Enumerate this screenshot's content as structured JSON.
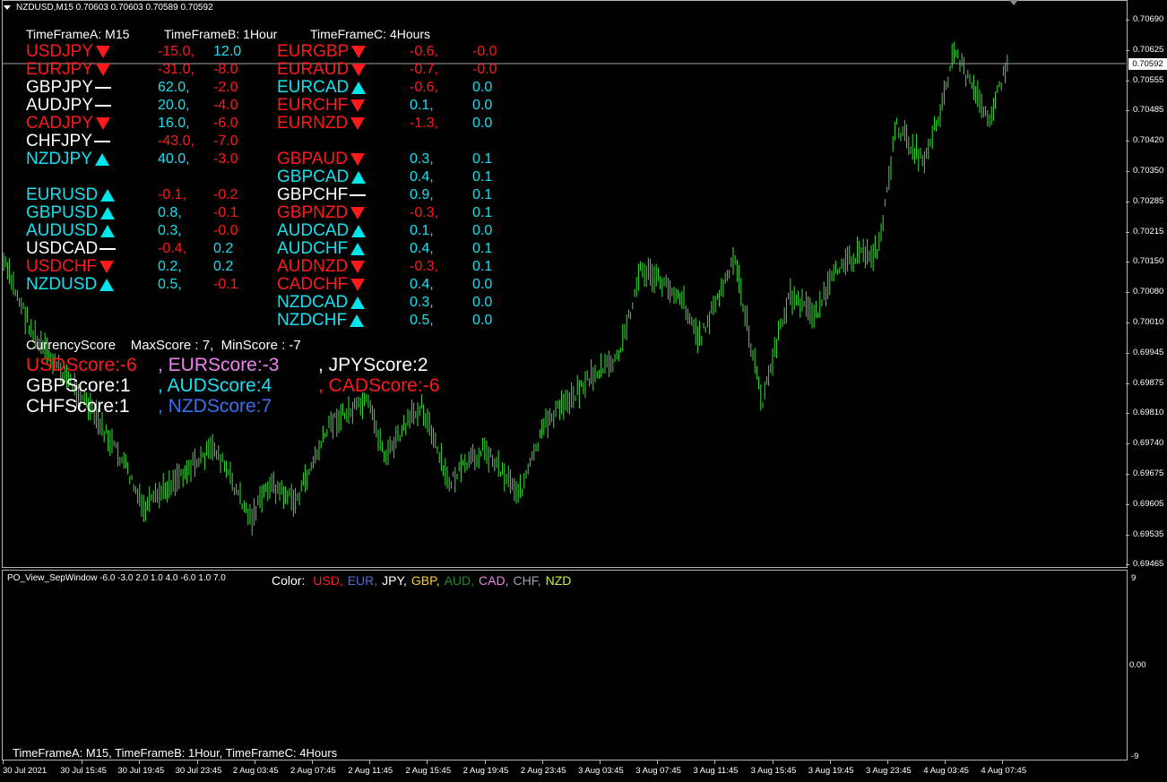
{
  "window": {
    "title": "NZDUSD,M15  0.70603 0.70603 0.70589 0.70592",
    "current_price": "0.70592"
  },
  "y_axis": [
    "0.70690",
    "0.70625",
    "0.70555",
    "0.70485",
    "0.70420",
    "0.70350",
    "0.70285",
    "0.70215",
    "0.70150",
    "0.70080",
    "0.70010",
    "0.69945",
    "0.69875",
    "0.69810",
    "0.69740",
    "0.69675",
    "0.69605",
    "0.69535",
    "0.69465"
  ],
  "x_axis": [
    "30 Jul 2021",
    "30 Jul 15:45",
    "30 Jul 19:45",
    "30 Jul 23:45",
    "2 Aug 03:45",
    "2 Aug 07:45",
    "2 Aug 11:45",
    "2 Aug 15:45",
    "2 Aug 19:45",
    "2 Aug 23:45",
    "3 Aug 03:45",
    "3 Aug 07:45",
    "3 Aug 11:45",
    "3 Aug 15:45",
    "3 Aug 19:45",
    "3 Aug 23:45",
    "4 Aug 03:45",
    "4 Aug 07:45"
  ],
  "headers": {
    "a": "TimeFrameA: M15",
    "b": "TimeFrameB: 1Hour",
    "c": "TimeFrameC: 4Hours"
  },
  "col1": [
    {
      "pair": "USDJPY",
      "dir": "down",
      "color": "red",
      "v1": "-15.0,",
      "c1": "red",
      "v2": "12.0",
      "c2": "cyan"
    },
    {
      "pair": "EURJPY",
      "dir": "down",
      "color": "red",
      "v1": "-31.0,",
      "c1": "red",
      "v2": "-8.0",
      "c2": "red"
    },
    {
      "pair": "GBPJPY",
      "dir": "flat",
      "color": "white",
      "v1": "62.0,",
      "c1": "cyan",
      "v2": "-2.0",
      "c2": "red"
    },
    {
      "pair": "AUDJPY",
      "dir": "flat",
      "color": "white",
      "v1": "20.0,",
      "c1": "cyan",
      "v2": "-4.0",
      "c2": "red"
    },
    {
      "pair": "CADJPY",
      "dir": "down",
      "color": "red",
      "v1": "16.0,",
      "c1": "cyan",
      "v2": "-6.0",
      "c2": "red"
    },
    {
      "pair": "CHFJPY",
      "dir": "flat",
      "color": "white",
      "v1": "-43.0,",
      "c1": "red",
      "v2": "-7.0",
      "c2": "red"
    },
    {
      "pair": "NZDJPY",
      "dir": "up",
      "color": "cyan",
      "v1": "40.0,",
      "c1": "cyan",
      "v2": "-3.0",
      "c2": "red"
    },
    {
      "pair": "",
      "dir": "",
      "color": "",
      "v1": "",
      "c1": "",
      "v2": "",
      "c2": ""
    },
    {
      "pair": "EURUSD",
      "dir": "up",
      "color": "cyan",
      "v1": "-0.1,",
      "c1": "red",
      "v2": "-0.2",
      "c2": "red"
    },
    {
      "pair": "GBPUSD",
      "dir": "up",
      "color": "cyan",
      "v1": "0.8,",
      "c1": "cyan",
      "v2": "-0.1",
      "c2": "red"
    },
    {
      "pair": "AUDUSD",
      "dir": "up",
      "color": "cyan",
      "v1": "0.3,",
      "c1": "cyan",
      "v2": "-0.0",
      "c2": "red"
    },
    {
      "pair": "USDCAD",
      "dir": "flat",
      "color": "white",
      "v1": "-0.4,",
      "c1": "red",
      "v2": "0.2",
      "c2": "cyan"
    },
    {
      "pair": "USDCHF",
      "dir": "down",
      "color": "red",
      "v1": "0.2,",
      "c1": "cyan",
      "v2": "0.2",
      "c2": "cyan"
    },
    {
      "pair": "NZDUSD",
      "dir": "up",
      "color": "cyan",
      "v1": "0.5,",
      "c1": "cyan",
      "v2": "-0.1",
      "c2": "red"
    }
  ],
  "col2": [
    {
      "pair": "EURGBP",
      "dir": "down",
      "color": "red",
      "v1": "-0.6,",
      "c1": "red",
      "v2": "-0.0",
      "c2": "red"
    },
    {
      "pair": "EURAUD",
      "dir": "down",
      "color": "red",
      "v1": "-0.7,",
      "c1": "red",
      "v2": "-0.0",
      "c2": "red"
    },
    {
      "pair": "EURCAD",
      "dir": "up",
      "color": "cyan",
      "v1": "-0.6,",
      "c1": "red",
      "v2": "0.0",
      "c2": "cyan"
    },
    {
      "pair": "EURCHF",
      "dir": "down",
      "color": "red",
      "v1": "0.1,",
      "c1": "cyan",
      "v2": "0.0",
      "c2": "cyan"
    },
    {
      "pair": "EURNZD",
      "dir": "down",
      "color": "red",
      "v1": "-1.3,",
      "c1": "red",
      "v2": "0.0",
      "c2": "cyan"
    },
    {
      "pair": "",
      "dir": "",
      "color": "",
      "v1": "",
      "c1": "",
      "v2": "",
      "c2": ""
    },
    {
      "pair": "GBPAUD",
      "dir": "down",
      "color": "red",
      "v1": "0.3,",
      "c1": "cyan",
      "v2": "0.1",
      "c2": "cyan"
    },
    {
      "pair": "GBPCAD",
      "dir": "up",
      "color": "cyan",
      "v1": "0.4,",
      "c1": "cyan",
      "v2": "0.1",
      "c2": "cyan"
    },
    {
      "pair": "GBPCHF",
      "dir": "flat",
      "color": "white",
      "v1": "0.9,",
      "c1": "cyan",
      "v2": "0.1",
      "c2": "cyan"
    },
    {
      "pair": "GBPNZD",
      "dir": "down",
      "color": "red",
      "v1": "-0.3,",
      "c1": "red",
      "v2": "0.1",
      "c2": "cyan"
    },
    {
      "pair": "AUDCAD",
      "dir": "up",
      "color": "cyan",
      "v1": "0.1,",
      "c1": "cyan",
      "v2": "0.0",
      "c2": "cyan"
    },
    {
      "pair": "AUDCHF",
      "dir": "up",
      "color": "cyan",
      "v1": "0.4,",
      "c1": "cyan",
      "v2": "0.1",
      "c2": "cyan"
    },
    {
      "pair": "AUDNZD",
      "dir": "down",
      "color": "red",
      "v1": "-0.3,",
      "c1": "red",
      "v2": "0.1",
      "c2": "cyan"
    },
    {
      "pair": "CADCHF",
      "dir": "down",
      "color": "red",
      "v1": "0.4,",
      "c1": "cyan",
      "v2": "0.0",
      "c2": "cyan"
    },
    {
      "pair": "NZDCAD",
      "dir": "up",
      "color": "cyan",
      "v1": "0.3,",
      "c1": "cyan",
      "v2": "0.0",
      "c2": "cyan"
    },
    {
      "pair": "NZDCHF",
      "dir": "up",
      "color": "cyan",
      "v1": "0.5,",
      "c1": "cyan",
      "v2": "0.0",
      "c2": "cyan"
    }
  ],
  "score_header": "CurrencyScore    MaxScore : 7,  MinScore : -7",
  "scores": [
    [
      {
        "t": "USDScore:-6",
        "c": "#ff1a1a"
      },
      {
        "t": ", EURScore:-3",
        "c": "#ee82ee"
      },
      {
        "t": ", JPYScore:2",
        "c": "#ffffff"
      }
    ],
    [
      {
        "t": "GBPScore:1",
        "c": "#ffffff"
      },
      {
        "t": ", AUDScore:4",
        "c": "#16e0f0"
      },
      {
        "t": ", CADScore:-6",
        "c": "#ff1a1a"
      }
    ],
    [
      {
        "t": "CHFScore:1",
        "c": "#ffffff"
      },
      {
        "t": ", NZDScore:7",
        "c": "#3a6ff0"
      }
    ]
  ],
  "sub_window": {
    "title": "PO_View_SepWindow -6.0 -3.0 2.0 1.0 4.0 -6.0 1.0 7.0",
    "legend_label": "Color:",
    "legend": [
      {
        "t": "USD,",
        "c": "#ff2020"
      },
      {
        "t": "EUR,",
        "c": "#4a6fd8"
      },
      {
        "t": "JPY,",
        "c": "#ffffff"
      },
      {
        "t": "GBP,",
        "c": "#ffcc33"
      },
      {
        "t": "AUD,",
        "c": "#1e8b1e"
      },
      {
        "t": "CAD,",
        "c": "#ee82ee"
      },
      {
        "t": "CHF,",
        "c": "#9aa4b2"
      },
      {
        "t": "NZD",
        "c": "#c5f53c"
      }
    ],
    "y_top": "9",
    "y_zero": "0.00",
    "y_bottom": "-9",
    "footer": "TimeFrameA: M15, TimeFrameB: 1Hour, TimeFrameC: 4Hours"
  }
}
